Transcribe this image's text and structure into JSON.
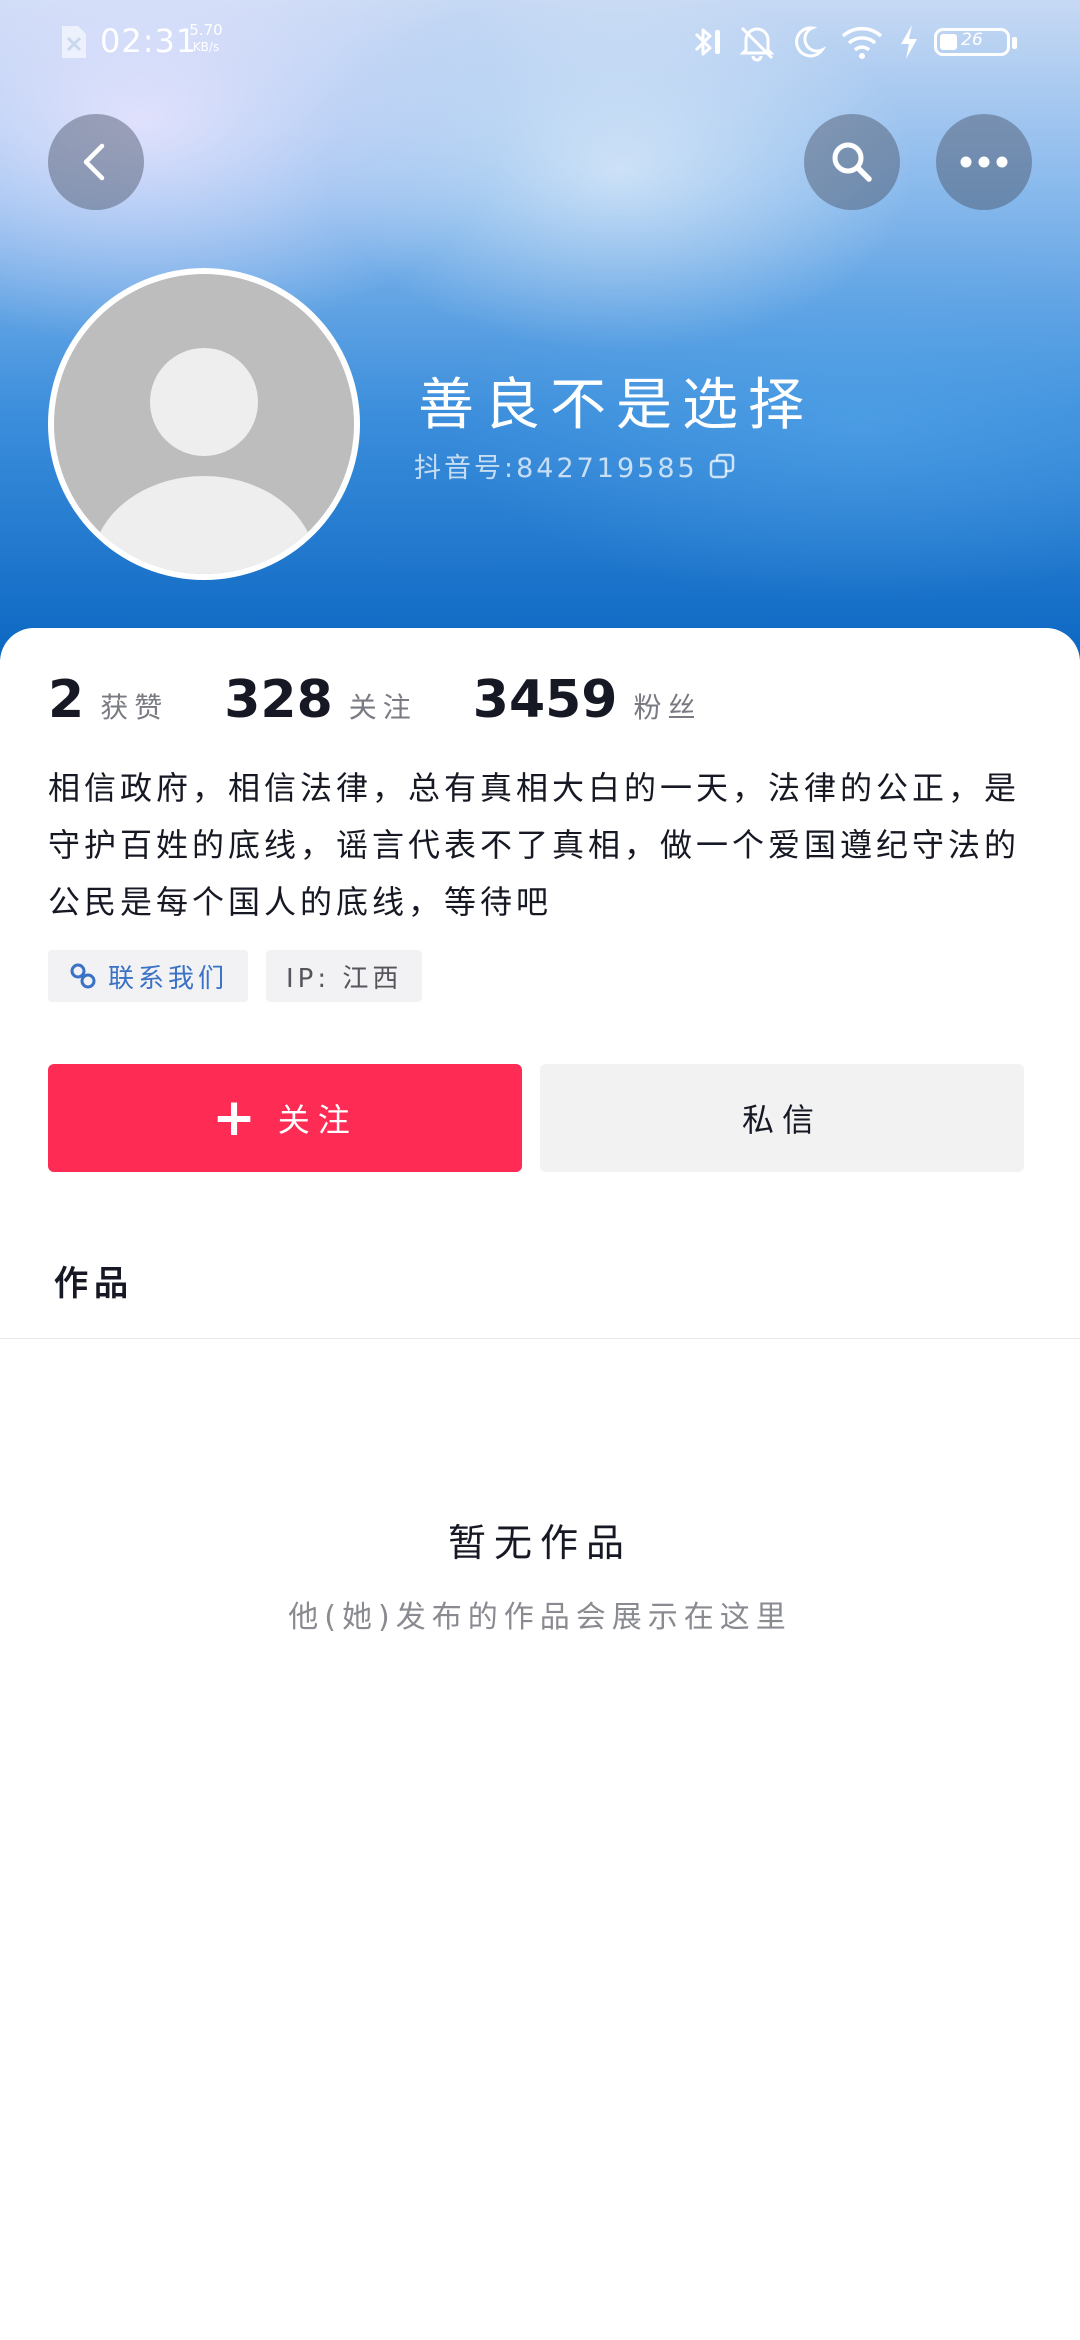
{
  "status_bar": {
    "time": "02:31",
    "net_speed": "5.70",
    "net_unit": "KB/s",
    "battery": "26",
    "battery_level": 0.26
  },
  "profile": {
    "nickname": "善良不是选择",
    "douyin_id": "抖音号:842719585"
  },
  "stats": [
    {
      "value": "2",
      "label": "获赞"
    },
    {
      "value": "328",
      "label": "关注"
    },
    {
      "value": "3459",
      "label": "粉丝"
    }
  ],
  "bio": "相信政府，相信法律，总有真相大白的一天，法律的公正，是守护百姓的底线，谣言代表不了真相，做一个爱国遵纪守法的公民是每个国人的底线，等待吧",
  "tags": {
    "contact": "联系我们",
    "ip": "IP: 江西"
  },
  "actions": {
    "follow_plus": "+",
    "follow": "关注",
    "message": "私信"
  },
  "tabs": {
    "works": "作品"
  },
  "empty": {
    "title": "暂无作品",
    "subtitle": "他(她)发布的作品会展示在这里"
  },
  "icons": [
    "back-icon",
    "search-icon",
    "more-icon",
    "copy-icon",
    "link-icon",
    "bluetooth-icon",
    "mute-icon",
    "moon-icon",
    "wifi-icon",
    "charging-icon"
  ],
  "colors": {
    "follow_button": "#fe2c55",
    "contact_tag_text": "#3a72c6"
  }
}
